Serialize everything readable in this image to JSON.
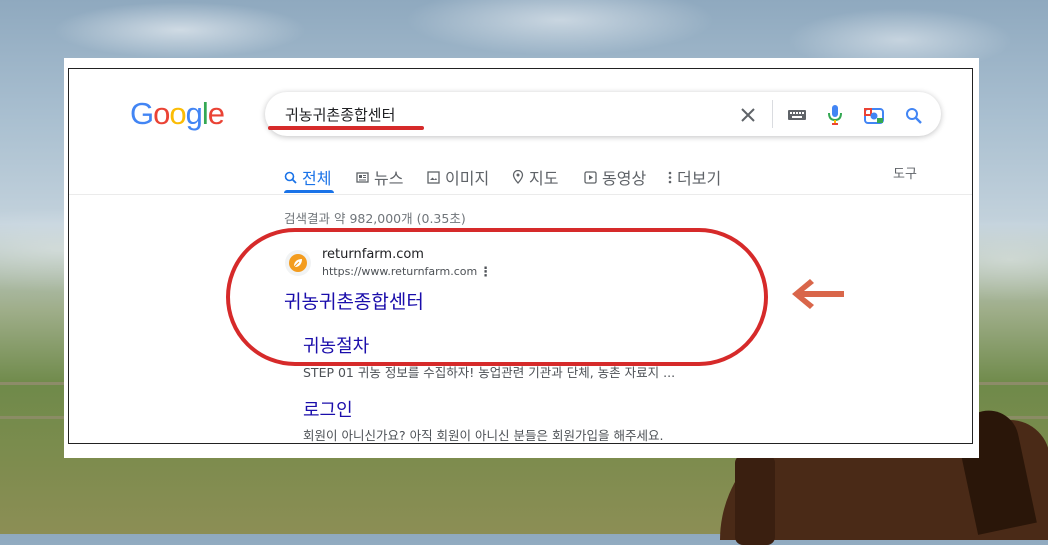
{
  "logo": {
    "letters": [
      "G",
      "o",
      "o",
      "g",
      "l",
      "e"
    ],
    "colors": [
      "#4285F4",
      "#EA4335",
      "#FBBC05",
      "#4285F4",
      "#34A853",
      "#EA4335"
    ]
  },
  "search": {
    "query": "귀농귀촌종합센터"
  },
  "icons": {
    "clear": "close-icon",
    "keyboard": "keyboard-icon",
    "voice": "mic-icon",
    "lens": "camera-icon",
    "submit": "search-icon"
  },
  "tabs": [
    {
      "label": "전체",
      "icon": "search-icon",
      "active": true
    },
    {
      "label": "뉴스",
      "icon": "news-icon"
    },
    {
      "label": "이미지",
      "icon": "image-icon"
    },
    {
      "label": "지도",
      "icon": "map-pin-icon"
    },
    {
      "label": "동영상",
      "icon": "play-icon"
    },
    {
      "label": "더보기",
      "icon": "more-vert-icon"
    }
  ],
  "tools_label": "도구",
  "stats": "검색결과 약 982,000개 (0.35초)",
  "result": {
    "site_name": "returnfarm.com",
    "url": "https://www.returnfarm.com",
    "title": "귀농귀촌종합센터",
    "sublinks": [
      {
        "title": "귀농절차",
        "desc": "STEP 01 귀농 정보를 수집하자! 농업관련 기관과 단체, 농촌 자료지 ..."
      },
      {
        "title": "로그인",
        "desc": "회원이 아니신가요? 아직 회원이 아니신 분들은 회원가입을 해주세요."
      }
    ]
  },
  "annotation_color": "#d62a2a",
  "arrow_color": "#d9664a"
}
